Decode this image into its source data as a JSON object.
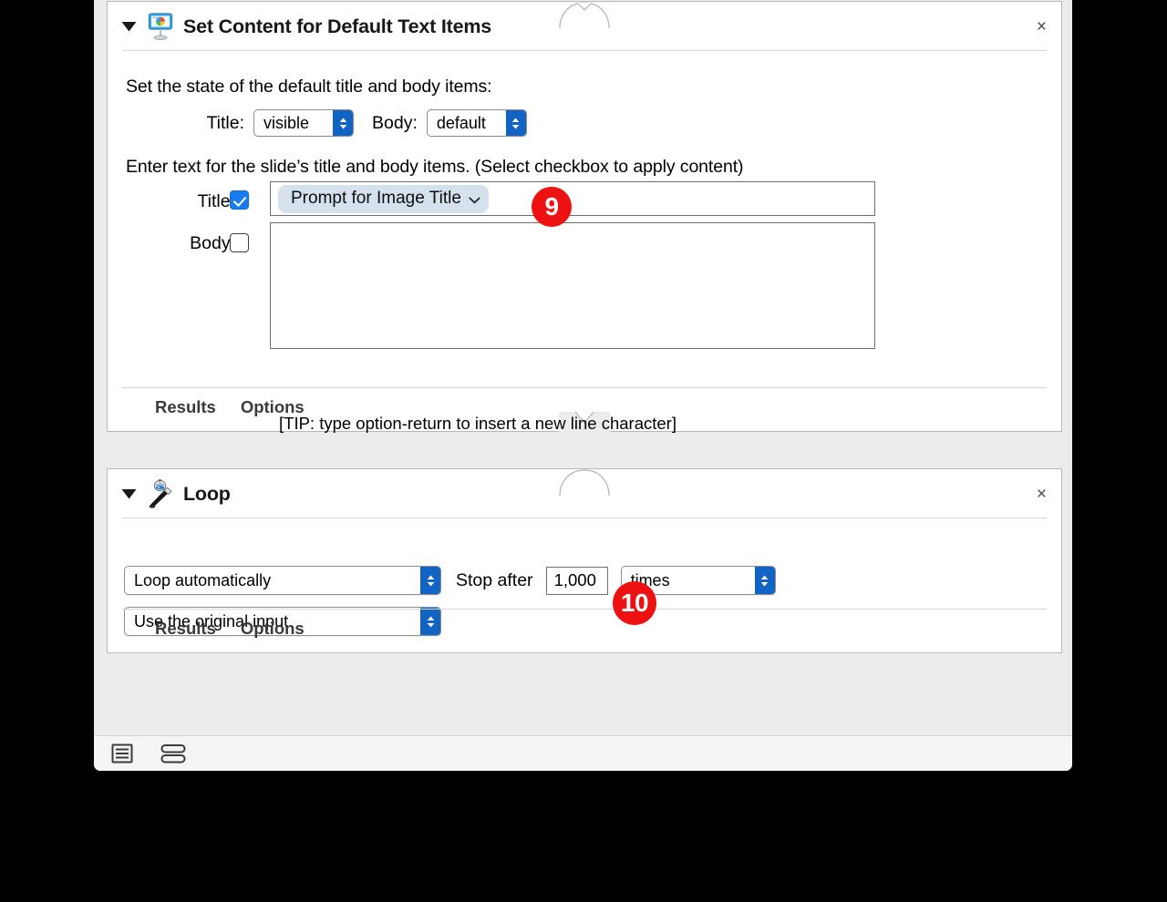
{
  "window": {
    "bottom_toolbar": {
      "view_list_icon": "list-view-icon",
      "view_split_icon": "split-view-icon"
    }
  },
  "actions": [
    {
      "id": "set-content",
      "title": "Set Content for Default Text Items",
      "icon": "keynote-presentation-icon",
      "disclosure": "triangle-down-icon",
      "close_label": "×",
      "description_1": "Set the state of the default title and body items:",
      "description_2": "Enter text for the slide’s title and body items. (Select checkbox to apply content)",
      "state_row": {
        "title_label": "Title:",
        "title_value": "visible",
        "body_label": "Body:",
        "body_value": "default"
      },
      "content_rows": {
        "title_label": "Title:",
        "title_checked": true,
        "title_token": "Prompt for Image Title",
        "body_label": "Body:",
        "body_checked": false,
        "body_value": ""
      },
      "tip": "[TIP: type option-return to insert a new line character]",
      "footer_tabs": [
        "Results",
        "Options"
      ]
    },
    {
      "id": "loop",
      "title": "Loop",
      "icon": "automator-robot-icon",
      "disclosure": "triangle-down-icon",
      "close_label": "×",
      "mode_value": "Loop automatically",
      "stop_after_label": "Stop after",
      "stop_after_value": "1,000",
      "stop_unit_value": "times",
      "input_value": "Use the original input",
      "footer_tabs": [
        "Results",
        "Options"
      ]
    }
  ],
  "annotations": [
    {
      "id": "badge-9",
      "label": "9",
      "color": "#ee1111"
    },
    {
      "id": "badge-10",
      "label": "10",
      "color": "#ee1111"
    }
  ]
}
